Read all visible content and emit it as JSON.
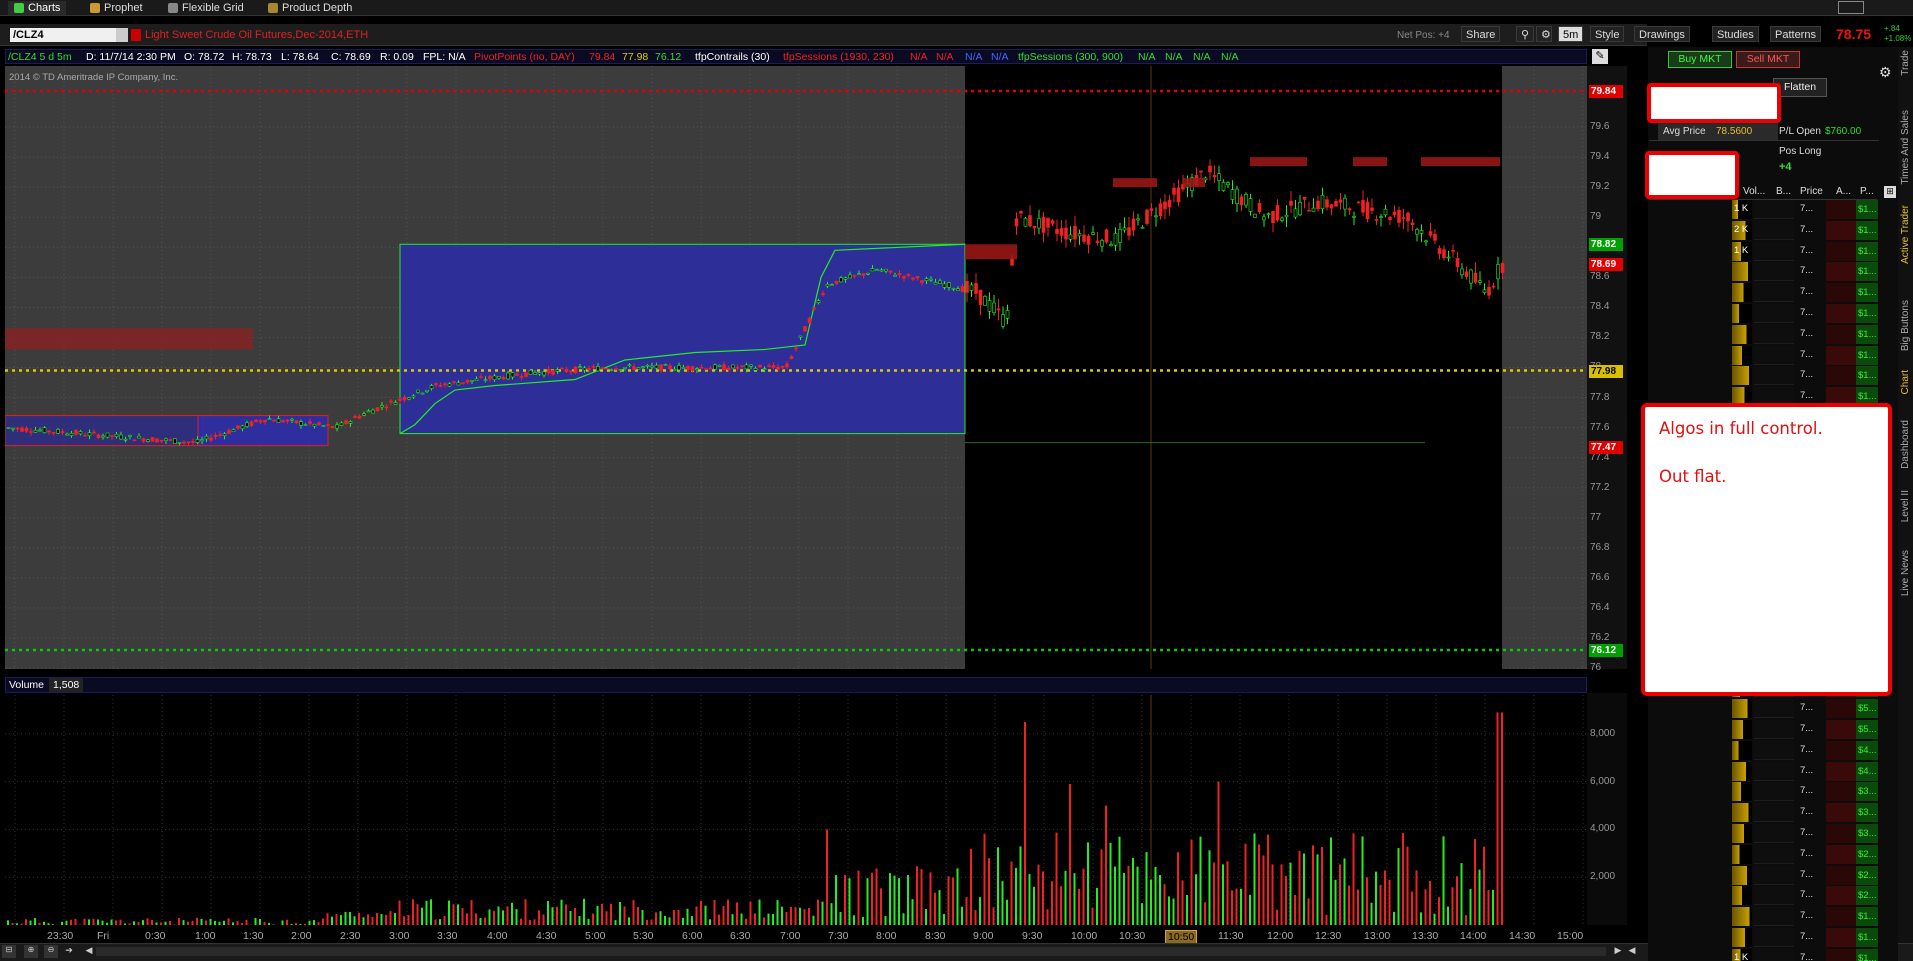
{
  "top_tabs": [
    {
      "label": "Charts",
      "icon": "charts-icon"
    },
    {
      "label": "Prophet",
      "icon": "prophet-icon"
    },
    {
      "label": "Flexible Grid",
      "icon": "grid-icon"
    },
    {
      "label": "Product Depth",
      "icon": "depth-icon"
    }
  ],
  "symbol": "/CLZ4",
  "description": "Light Sweet Crude Oil Futures,Dec-2014,ETH",
  "net_pos": "Net Pos: +4",
  "toolbar": {
    "share": "Share",
    "interval": "5m",
    "style": "Style",
    "drawings": "Drawings",
    "studies": "Studies",
    "patterns": "Patterns"
  },
  "last_price": "78.75",
  "last_change": "+.84",
  "last_change_pct": "+1.08%",
  "info_bar": {
    "sym": "/CLZ4 5 d 5m",
    "date": "D: 11/7/14 2:30 PM",
    "open": "O: 78.72",
    "high": "H: 78.73",
    "low": "L: 78.64",
    "close": "C: 78.69",
    "range": "R: 0.09",
    "fpl": "FPL: N/A",
    "pivot": "PivotPoints (no, DAY)",
    "pivot_vals": [
      "79.84",
      "77.98",
      "76.12"
    ],
    "contrails": "tfpContrails (30)",
    "sessions1": "tfpSessions (1930, 230)",
    "na": "N/A",
    "sessions2": "tfpSessions (300, 900)"
  },
  "copyright": "2014 © TD Ameritrade IP Company, Inc.",
  "price_axis": [
    "79.6",
    "79.4",
    "79.2",
    "79",
    "78.8",
    "78.6",
    "78.4",
    "78.2",
    "78",
    "77.8",
    "77.6",
    "77.4",
    "77.2",
    "77",
    "76.8",
    "76.6",
    "76.4",
    "76.2",
    "76"
  ],
  "price_tags": [
    {
      "text": "79.84",
      "color": "#e00000"
    },
    {
      "text": "78.82",
      "color": "#00a000"
    },
    {
      "text": "78.69",
      "color": "#e00000"
    },
    {
      "text": "77.98",
      "color": "#d8c000"
    },
    {
      "text": "77.47",
      "color": "#e00000"
    },
    {
      "text": "76.12",
      "color": "#00a000"
    }
  ],
  "volume": {
    "label": "Volume",
    "value": "1,508",
    "axis": [
      "8,000",
      "6,000",
      "4,000",
      "2,000"
    ]
  },
  "time_axis": [
    "23:30",
    "Fri",
    "0:30",
    "1:00",
    "1:30",
    "2:00",
    "2:30",
    "3:00",
    "3:30",
    "4:00",
    "4:30",
    "5:00",
    "5:30",
    "6:00",
    "6:30",
    "7:00",
    "7:30",
    "8:00",
    "8:30",
    "9:00",
    "9:30",
    "10:00",
    "10:30",
    "10:50",
    "11:30",
    "12:00",
    "12:30",
    "13:00",
    "13:30",
    "14:00",
    "14:30",
    "15:00"
  ],
  "active_trader": {
    "buy": "Buy MKT",
    "sell": "Sell MKT",
    "flatten": "Flatten",
    "avg_price_label": "Avg Price",
    "avg_price": "78.5600",
    "pl_open_label": "P/L Open",
    "pl_open": "$760.00",
    "pos_label": "Pos Long",
    "pos_value": "+4",
    "ladder_headers": [
      "Vol...",
      "B...",
      "Price",
      "A...",
      "P..."
    ],
    "ladder_vol": [
      "1 K",
      "2 K",
      "1 K",
      "",
      "",
      "",
      "",
      "",
      "",
      "",
      "",
      "",
      "",
      "",
      "",
      "",
      "",
      "",
      "",
      "",
      "",
      "",
      "",
      "",
      "",
      "",
      "",
      "",
      "",
      "",
      "",
      "",
      "",
      "",
      "",
      "",
      "1 K",
      ""
    ],
    "ladder_price": "7...",
    "ladder_pl": [
      "$1...",
      "$1...",
      "$1...",
      "$1...",
      "$1...",
      "$1...",
      "$1...",
      "$1...",
      "$1...",
      "$1...",
      "$1...",
      "",
      "",
      "",
      "",
      "",
      "",
      "",
      "",
      "",
      "",
      "",
      "",
      "",
      "$5...",
      "$5...",
      "$4...",
      "$4...",
      "$3...",
      "$3...",
      "$3...",
      "$2...",
      "$2...",
      "$2...",
      "$1...",
      "$1...",
      "$1...",
      "$1..."
    ]
  },
  "side_tabs": [
    "Trade",
    "Times And Sales",
    "Active Trader",
    "Big Buttons",
    "Chart",
    "Dashboard",
    "Level II",
    "Live News"
  ],
  "annotation": {
    "line1": "Algos in full control.",
    "line2": "Out flat."
  }
}
